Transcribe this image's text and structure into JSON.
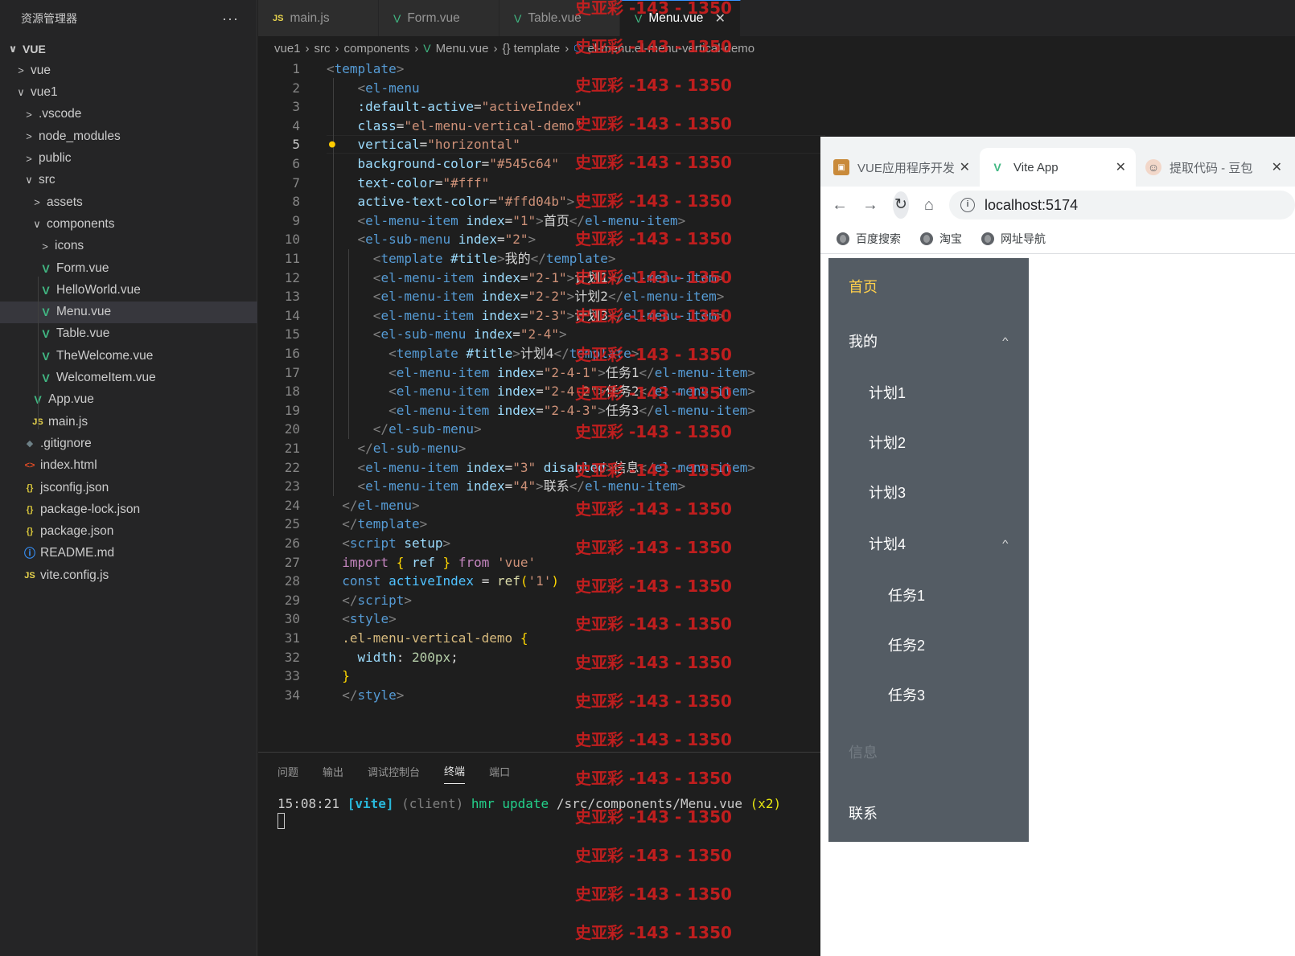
{
  "sidebar": {
    "title": "资源管理器",
    "more": "···",
    "items": [
      {
        "label": "VUE",
        "chev": "∨",
        "icon": "",
        "top": 0
      },
      {
        "label": "vue",
        "chev": ">"
      },
      {
        "label": "vue1",
        "chev": "∨"
      },
      {
        "label": ".vscode",
        "chev": ">"
      },
      {
        "label": "node_modules",
        "chev": ">"
      },
      {
        "label": "public",
        "chev": ">"
      },
      {
        "label": "src",
        "chev": "∨"
      },
      {
        "label": "assets",
        "chev": ">"
      },
      {
        "label": "components",
        "chev": "∨"
      },
      {
        "label": "icons",
        "chev": ">"
      },
      {
        "label": "Form.vue",
        "icon": "vue"
      },
      {
        "label": "HelloWorld.vue",
        "icon": "vue"
      },
      {
        "label": "Menu.vue",
        "icon": "vue"
      },
      {
        "label": "Table.vue",
        "icon": "vue"
      },
      {
        "label": "TheWelcome.vue",
        "icon": "vue"
      },
      {
        "label": "WelcomeItem.vue",
        "icon": "vue"
      },
      {
        "label": "App.vue",
        "icon": "vue"
      },
      {
        "label": "main.js",
        "icon": "js"
      },
      {
        "label": ".gitignore",
        "icon": "git"
      },
      {
        "label": "index.html",
        "icon": "html"
      },
      {
        "label": "jsconfig.json",
        "icon": "json"
      },
      {
        "label": "package-lock.json",
        "icon": "json"
      },
      {
        "label": "package.json",
        "icon": "json"
      },
      {
        "label": "README.md",
        "icon": "info"
      },
      {
        "label": "vite.config.js",
        "icon": "js"
      }
    ]
  },
  "tabs": [
    {
      "label": "main.js",
      "icon": "JS"
    },
    {
      "label": "Form.vue",
      "icon": "V"
    },
    {
      "label": "Table.vue",
      "icon": "V"
    },
    {
      "label": "Menu.vue",
      "icon": "V",
      "close": "✕"
    }
  ],
  "breadcrumb": {
    "p1": "vue1",
    "p2": "src",
    "p3": "components",
    "p4": "Menu.vue",
    "p5": "{} template",
    "p6": "el-menu.el-menu-vertical-demo"
  },
  "panel": {
    "tabs": [
      "问题",
      "输出",
      "调试控制台",
      "终端",
      "端口"
    ],
    "active_tab": "终端",
    "term_time": "15:08:21",
    "term_vite": "[vite]",
    "term_client": "(client)",
    "term_hmr": "hmr update",
    "term_path": "/src/components/Menu.vue",
    "term_x2": "(x2)"
  },
  "watermark": "史亚彩 -143 - 1350",
  "browser": {
    "tabs": [
      {
        "label": "VUE应用程序开发",
        "close": "✕"
      },
      {
        "label": "Vite App",
        "close": "✕"
      },
      {
        "label": "提取代码 - 豆包",
        "close": "✕"
      }
    ],
    "url": "localhost:5174",
    "bookmarks": [
      "百度搜索",
      "淘宝",
      "网址导航"
    ],
    "menu": {
      "items": [
        "首页",
        "我的",
        "计划1",
        "计划2",
        "计划3",
        "计划4",
        "任务1",
        "任务2",
        "任务3",
        "信息",
        "联系"
      ],
      "background_color": "#545c64",
      "text_color": "#fff",
      "active_text_color": "#ffd04b"
    }
  }
}
